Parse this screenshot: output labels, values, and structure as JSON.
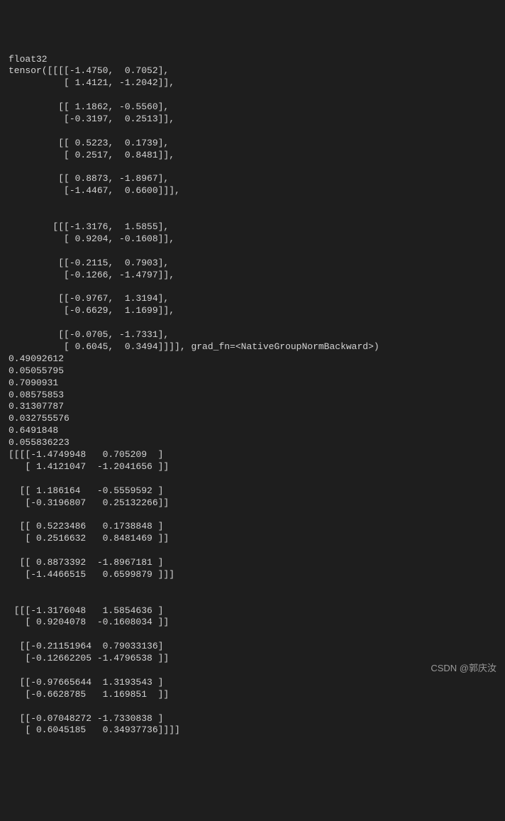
{
  "terminal": {
    "lines": [
      "float32",
      "tensor([[[[-1.4750,  0.7052],",
      "          [ 1.4121, -1.2042]],",
      "",
      "         [[ 1.1862, -0.5560],",
      "          [-0.3197,  0.2513]],",
      "",
      "         [[ 0.5223,  0.1739],",
      "          [ 0.2517,  0.8481]],",
      "",
      "         [[ 0.8873, -1.8967],",
      "          [-1.4467,  0.6600]]],",
      "",
      "",
      "        [[[-1.3176,  1.5855],",
      "          [ 0.9204, -0.1608]],",
      "",
      "         [[-0.2115,  0.7903],",
      "          [-0.1266, -1.4797]],",
      "",
      "         [[-0.9767,  1.3194],",
      "          [-0.6629,  1.1699]],",
      "",
      "         [[-0.0705, -1.7331],",
      "          [ 0.6045,  0.3494]]]], grad_fn=<NativeGroupNormBackward>)",
      "0.49092612",
      "0.05055795",
      "0.7090931",
      "0.08575853",
      "0.31307787",
      "0.032755576",
      "0.6491848",
      "0.055836223",
      "[[[[-1.4749948   0.705209  ]",
      "   [ 1.4121047  -1.2041656 ]]",
      "",
      "  [[ 1.186164   -0.5559592 ]",
      "   [-0.3196807   0.25132266]]",
      "",
      "  [[ 0.5223486   0.1738848 ]",
      "   [ 0.2516632   0.8481469 ]]",
      "",
      "  [[ 0.8873392  -1.8967181 ]",
      "   [-1.4466515   0.6599879 ]]]",
      "",
      "",
      " [[[-1.3176048   1.5854636 ]",
      "   [ 0.9204078  -0.1608034 ]]",
      "",
      "  [[-0.21151964  0.79033136]",
      "   [-0.12662205 -1.4796538 ]]",
      "",
      "  [[-0.97665644  1.3193543 ]",
      "   [-0.6628785   1.169851  ]]",
      "",
      "  [[-0.07048272 -1.7330838 ]",
      "   [ 0.6045185   0.34937736]]]]"
    ]
  },
  "watermark": {
    "text": "CSDN @郭庆汝"
  }
}
